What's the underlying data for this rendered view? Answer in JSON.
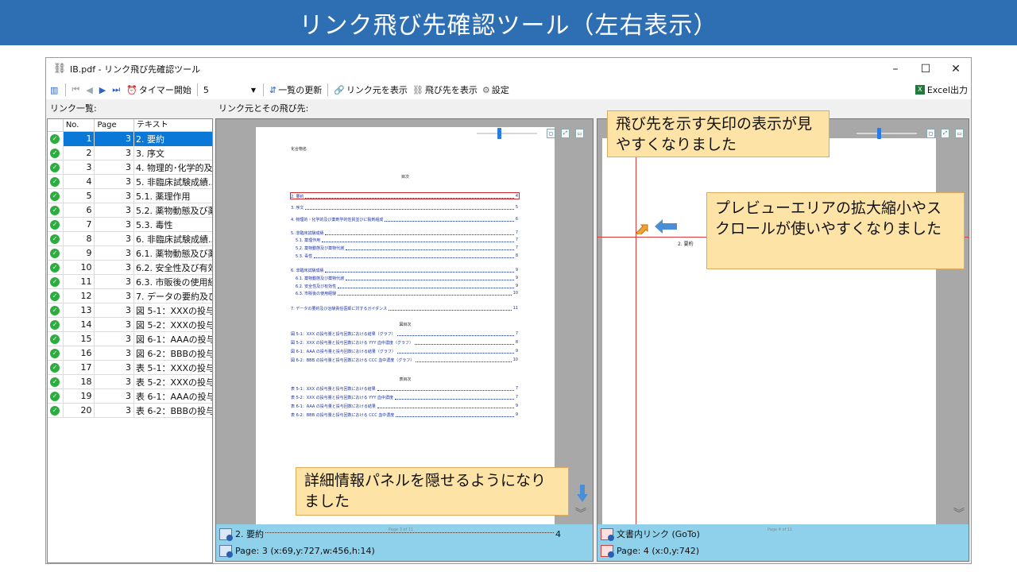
{
  "banner": {
    "title": "リンク飛び先確認ツール（左右表示）"
  },
  "window": {
    "title": "IB.pdf - リンク飛び先確認ツール",
    "controls": [
      "–",
      "☐",
      "✕"
    ]
  },
  "toolbar": {
    "timer_label": "タイマー開始",
    "interval_value": "5",
    "refresh_label": "一覧の更新",
    "show_source_label": "リンク元を表示",
    "show_dest_label": "飛び先を表示",
    "settings_label": "設定",
    "excel_label": "Excel出力"
  },
  "labels": {
    "link_list": "リンク一覧:",
    "source_dest": "リンク元とその飛び先:"
  },
  "list": {
    "headers": [
      "No.",
      "Page",
      "テキスト"
    ],
    "rows": [
      {
        "no": "1",
        "page": "3",
        "text": "2. 要約"
      },
      {
        "no": "2",
        "page": "3",
        "text": "3. 序文"
      },
      {
        "no": "3",
        "page": "3",
        "text": "4. 物理的･化学的及..."
      },
      {
        "no": "4",
        "page": "3",
        "text": "5. 非臨床試験成績..."
      },
      {
        "no": "5",
        "page": "3",
        "text": "5.1. 薬理作用"
      },
      {
        "no": "6",
        "page": "3",
        "text": "5.2. 薬物動態及び薬..."
      },
      {
        "no": "7",
        "page": "3",
        "text": "5.3. 毒性"
      },
      {
        "no": "8",
        "page": "3",
        "text": "6. 非臨床試験成績..."
      },
      {
        "no": "9",
        "page": "3",
        "text": "6.1. 薬物動態及び薬..."
      },
      {
        "no": "10",
        "page": "3",
        "text": "6.2. 安全性及び有効..."
      },
      {
        "no": "11",
        "page": "3",
        "text": "6.3. 市販後の使用経..."
      },
      {
        "no": "12",
        "page": "3",
        "text": "7. データの要約及び..."
      },
      {
        "no": "13",
        "page": "3",
        "text": "図 5-1：XXXの投与..."
      },
      {
        "no": "14",
        "page": "3",
        "text": "図 5-2：XXXの投与..."
      },
      {
        "no": "15",
        "page": "3",
        "text": "図 6-1：AAAの投与..."
      },
      {
        "no": "16",
        "page": "3",
        "text": "図 6-2：BBBの投与..."
      },
      {
        "no": "17",
        "page": "3",
        "text": "表 5-1：XXXの投与..."
      },
      {
        "no": "18",
        "page": "3",
        "text": "表 5-2：XXXの投与..."
      },
      {
        "no": "19",
        "page": "3",
        "text": "表 6-1：AAAの投与..."
      },
      {
        "no": "20",
        "page": "3",
        "text": "表 6-2：BBBの投与..."
      }
    ]
  },
  "left_page": {
    "header_small": "化合物名",
    "toc_title": "目次",
    "toc": [
      {
        "t": "2. 要約",
        "p": "4"
      },
      {
        "t": "3. 序文",
        "p": "5"
      },
      {
        "t": "4. 物理的・化学的及び薬剤学的性質並びに製剤組成",
        "p": "6"
      },
      {
        "t": "5. 非臨床試験成績",
        "p": "7"
      },
      {
        "t": "5.1. 薬理作用",
        "p": "7"
      },
      {
        "t": "5.2. 薬物動態及び薬物代謝",
        "p": "7"
      },
      {
        "t": "5.3. 毒性",
        "p": "8"
      },
      {
        "t": "6. 非臨床試験成績",
        "p": "9"
      },
      {
        "t": "6.1. 薬物動態及び薬物代謝",
        "p": "9"
      },
      {
        "t": "6.2. 安全性及び有効性",
        "p": "9"
      },
      {
        "t": "6.3. 市販後の使用経験",
        "p": "10"
      },
      {
        "t": "7. データの要約及び治験責任医師に対するガイダンス",
        "p": "11"
      }
    ],
    "fig_title": "図目次",
    "figs": [
      {
        "t": "図 5-1：XXX の投与量と投与回数における結果（グラフ）",
        "p": "7"
      },
      {
        "t": "図 5-2：XXX の投与量と投与回数における YYY 血中濃度（グラフ）",
        "p": "8"
      },
      {
        "t": "図 6-1：AAA の投与量と投与回数における結果（グラフ）",
        "p": "9"
      },
      {
        "t": "図 6-2：BBB の投与量と投与回数における CCC 血中濃度（グラフ）",
        "p": "10"
      }
    ],
    "tbl_title": "表目次",
    "tbls": [
      {
        "t": "表 5-1：XXX の投与量と投与回数における結果",
        "p": "7"
      },
      {
        "t": "表 5-2：XXX の投与量と投与回数における YYY 血中濃度",
        "p": "7"
      },
      {
        "t": "表 6-1：AAA の投与量と投与回数における結果",
        "p": "9"
      },
      {
        "t": "表 6-2：BBB の投与量と投与回数における CCC 血中濃度",
        "p": "9"
      }
    ],
    "page_tag": "Page 3 of 11"
  },
  "right_page": {
    "heading": "2.  要約",
    "page_tag": "Page 4 of 11"
  },
  "info_left": {
    "line1": "2. 要約",
    "line1_page": "4",
    "line2": "Page: 3 (x:69,y:727,w:456,h:14)"
  },
  "info_right": {
    "line1": "文書内リンク (GoTo)",
    "line2": "Page: 4 (x:0,y:742)"
  },
  "callouts": {
    "arrow": "飛び先を示す矢印の表示が見やすくなりました",
    "preview": "プレビューエリアの拡大縮小やスクロールが使いやすくなりました",
    "panel": "詳細情報パネルを隠せるようになりました"
  },
  "colors": {
    "banner": "#2e6fb4",
    "selection": "#0a78d7",
    "info_panel": "#8fd1ea",
    "callout": "#fde3a6",
    "link_red": "#e03c3c"
  }
}
